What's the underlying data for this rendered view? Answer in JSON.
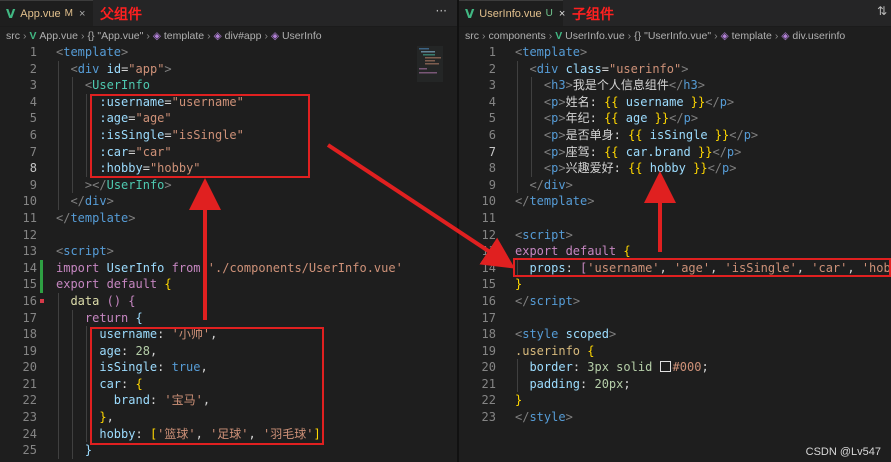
{
  "left": {
    "tab": {
      "name": "App.vue",
      "modified": "M",
      "close": "×"
    },
    "annotation": "父组件",
    "more": "···",
    "breadcrumb": [
      "src",
      "App.vue",
      "{} \"App.vue\"",
      "template",
      "div#app",
      "UserInfo"
    ],
    "lines": [
      {
        "n": "1"
      },
      {
        "n": "2"
      },
      {
        "n": "3"
      },
      {
        "n": "4"
      },
      {
        "n": "5"
      },
      {
        "n": "6"
      },
      {
        "n": "7"
      },
      {
        "n": "8"
      },
      {
        "n": "9"
      },
      {
        "n": "10"
      },
      {
        "n": "11"
      },
      {
        "n": "12"
      },
      {
        "n": "13"
      },
      {
        "n": "14"
      },
      {
        "n": "15"
      },
      {
        "n": "16"
      },
      {
        "n": "17"
      },
      {
        "n": "18"
      },
      {
        "n": "19"
      },
      {
        "n": "20"
      },
      {
        "n": "21"
      },
      {
        "n": "22"
      },
      {
        "n": "23"
      },
      {
        "n": "24"
      },
      {
        "n": "25"
      }
    ],
    "code": {
      "l1": "template",
      "l2_tag": "div",
      "l2_attr": "id",
      "l2_val": "\"app\"",
      "l3": "UserInfo",
      "l4_attr": ":username",
      "l4_val": "\"username\"",
      "l5_attr": ":age",
      "l5_val": "\"age\"",
      "l6_attr": ":isSingle",
      "l6_val": "\"isSingle\"",
      "l7_attr": ":car",
      "l7_val": "\"car\"",
      "l8_attr": ":hobby",
      "l8_val": "\"hobby\"",
      "l9": "UserInfo",
      "l10": "div",
      "l11": "template",
      "l13": "script",
      "l14_kw1": "import",
      "l14_id": "UserInfo",
      "l14_kw2": "from",
      "l14_str": "'./components/UserInfo.vue'",
      "l15_kw": "export default",
      "l16_fn": "data",
      "l17_kw": "return",
      "l18_key": "username",
      "l18_val": "'小帅'",
      "l19_key": "age",
      "l19_val": "28",
      "l20_key": "isSingle",
      "l20_val": "true",
      "l21_key": "car",
      "l22_key": "brand",
      "l22_val": "'宝马'",
      "l24_key": "hobby",
      "l24_v1": "'篮球'",
      "l24_v2": "'足球'",
      "l24_v3": "'羽毛球'"
    }
  },
  "right": {
    "tab": {
      "name": "UserInfo.vue",
      "modified": "U",
      "close": "×"
    },
    "annotation": "子组件",
    "breadcrumb": [
      "src",
      "components",
      "UserInfo.vue",
      "{} \"UserInfo.vue\"",
      "template",
      "div.userinfo"
    ],
    "lines": [
      {
        "n": "1"
      },
      {
        "n": "2"
      },
      {
        "n": "3"
      },
      {
        "n": "4"
      },
      {
        "n": "5"
      },
      {
        "n": "6"
      },
      {
        "n": "7"
      },
      {
        "n": "8"
      },
      {
        "n": "9"
      },
      {
        "n": "10"
      },
      {
        "n": "11"
      },
      {
        "n": "12"
      },
      {
        "n": "13"
      },
      {
        "n": "14"
      },
      {
        "n": "15"
      },
      {
        "n": "16"
      },
      {
        "n": "17"
      },
      {
        "n": "18"
      },
      {
        "n": "19"
      },
      {
        "n": "20"
      },
      {
        "n": "21"
      },
      {
        "n": "22"
      },
      {
        "n": "23"
      }
    ],
    "code": {
      "l1": "template",
      "l2_tag": "div",
      "l2_attr": "class",
      "l2_val": "\"userinfo\"",
      "l3_text": "我是个人信息组件",
      "l4_text": "姓名: ",
      "l4_var": "username",
      "l5_text": "年纪: ",
      "l5_var": "age",
      "l6_text": "是否单身: ",
      "l6_var": "isSingle",
      "l7_text": "座驾: ",
      "l7_var": "car.brand",
      "l8_text": "兴趣爱好: ",
      "l8_var": "hobby",
      "l9": "div",
      "l10": "template",
      "l12": "script",
      "l13_kw": "export default",
      "l14_key": "props",
      "l14_v1": "'username'",
      "l14_v2": "'age'",
      "l14_v3": "'isSingle'",
      "l14_v4": "'car'",
      "l14_v5": "'hobby'",
      "l16": "script",
      "l18_tag": "style",
      "l18_attr": "scoped",
      "l19_sel": ".userinfo",
      "l20_prop": "border",
      "l20_val1": "3px solid",
      "l20_val2": "#000",
      "l21_prop": "padding",
      "l21_val": "20px",
      "l23": "style"
    }
  },
  "watermark": "CSDN @Lv547",
  "colors": {
    "annotation": "#ff2020",
    "box": "#e02020",
    "vue": "#41b883"
  }
}
